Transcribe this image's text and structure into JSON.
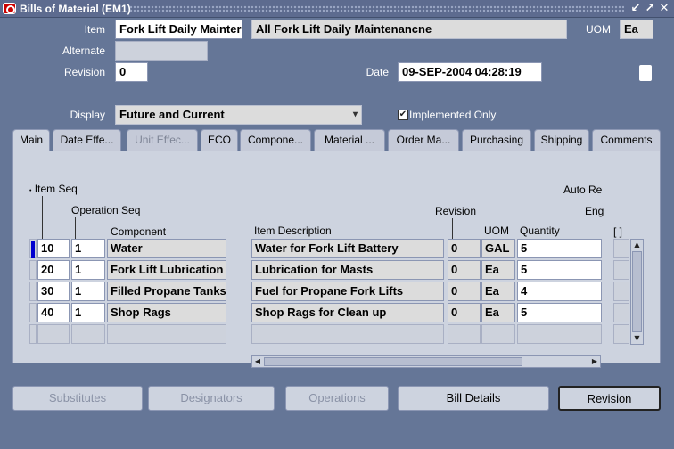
{
  "window": {
    "title": "Bills of Material (EM1)",
    "controls": [
      "↙",
      "↗",
      "✕"
    ]
  },
  "header": {
    "item_label": "Item",
    "item_value": "Fork Lift Daily Mainter",
    "item_desc": "All Fork Lift Daily Maintenancne",
    "uom_label": "UOM",
    "uom_value": "Ea",
    "alternate_label": "Alternate",
    "alternate_value": "",
    "revision_label": "Revision",
    "revision_value": "0",
    "date_label": "Date",
    "date_value": "09-SEP-2004 04:28:19",
    "flex_value": "[ ]",
    "display_label": "Display",
    "display_value": "Future and Current",
    "implemented_label": "Implemented Only",
    "implemented_checked": true
  },
  "tabs": [
    {
      "label": "Main",
      "active": true,
      "disabled": false
    },
    {
      "label": "Date Effe...",
      "active": false,
      "disabled": false
    },
    {
      "label": "Unit Effec...",
      "active": false,
      "disabled": true
    },
    {
      "label": "ECO",
      "active": false,
      "disabled": false
    },
    {
      "label": "Compone...",
      "active": false,
      "disabled": false
    },
    {
      "label": "Material ...",
      "active": false,
      "disabled": false
    },
    {
      "label": "Order Ma...",
      "active": false,
      "disabled": false
    },
    {
      "label": "Purchasing",
      "active": false,
      "disabled": false
    },
    {
      "label": "Shipping",
      "active": false,
      "disabled": false
    },
    {
      "label": "Comments",
      "active": false,
      "disabled": false
    }
  ],
  "grid": {
    "headers": {
      "item_seq": "Item Seq",
      "op_seq": "Operation Seq",
      "component": "Component",
      "desc": "Item Description",
      "revision": "Revision",
      "uom": "UOM",
      "quantity": "Quantity",
      "auto_re": "Auto Re",
      "eng": "Eng",
      "flex": "[ ]"
    },
    "rows": [
      {
        "item_seq": "10",
        "op_seq": "1",
        "component": "Water",
        "desc": "Water for Fork Lift Battery",
        "revision": "0",
        "uom": "GAL",
        "quantity": "5"
      },
      {
        "item_seq": "20",
        "op_seq": "1",
        "component": "Fork Lift Lubrication",
        "desc": "Lubrication for Masts",
        "revision": "0",
        "uom": "Ea",
        "quantity": "5"
      },
      {
        "item_seq": "30",
        "op_seq": "1",
        "component": "Filled Propane Tanks",
        "desc": "Fuel for Propane Fork Lifts",
        "revision": "0",
        "uom": "Ea",
        "quantity": "4"
      },
      {
        "item_seq": "40",
        "op_seq": "1",
        "component": "Shop Rags",
        "desc": "Shop Rags for Clean up",
        "revision": "0",
        "uom": "Ea",
        "quantity": "5"
      }
    ]
  },
  "buttons": {
    "substitutes": "Substitutes",
    "designators": "Designators",
    "operations": "Operations",
    "bill_details": "Bill Details",
    "revision": "Revision"
  }
}
